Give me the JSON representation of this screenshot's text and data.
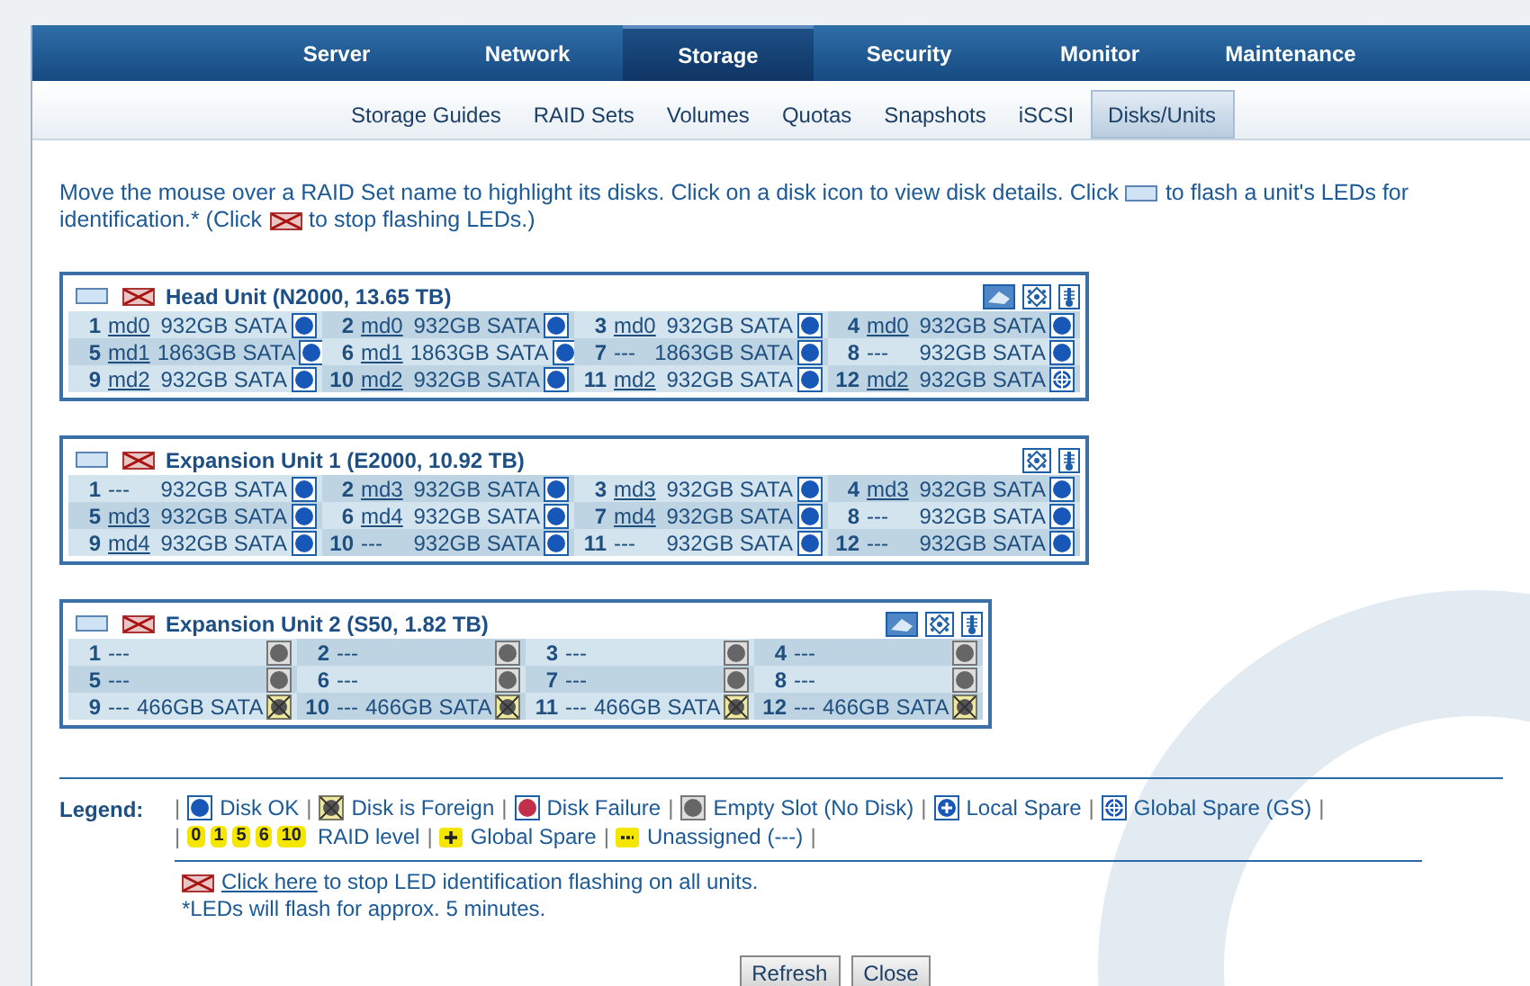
{
  "nav": [
    {
      "label": "Server",
      "selected": false
    },
    {
      "label": "Network",
      "selected": false
    },
    {
      "label": "Storage",
      "selected": true
    },
    {
      "label": "Security",
      "selected": false
    },
    {
      "label": "Monitor",
      "selected": false
    },
    {
      "label": "Maintenance",
      "selected": false
    }
  ],
  "subnav": [
    {
      "label": "Storage Guides",
      "selected": false
    },
    {
      "label": "RAID Sets",
      "selected": false
    },
    {
      "label": "Volumes",
      "selected": false
    },
    {
      "label": "Quotas",
      "selected": false
    },
    {
      "label": "Snapshots",
      "selected": false
    },
    {
      "label": "iSCSI",
      "selected": false
    },
    {
      "label": "Disks/Units",
      "selected": true
    }
  ],
  "intro": {
    "before": "Move the mouse over a RAID Set name to highlight its disks. Click on a disk icon to view disk details. Click",
    "middle": "to flash a unit's LEDs for identification.* (Click",
    "after": "to stop flashing LEDs.)"
  },
  "units": [
    {
      "title": "Head Unit (N2000, 13.65 TB)",
      "icons": [
        {
          "kind": "enclosure"
        },
        {
          "kind": "fan"
        },
        {
          "kind": "temperature"
        }
      ],
      "disks": [
        {
          "number": "1",
          "raid": "md0",
          "linked": true,
          "size": "932GB SATA",
          "kind": "ok"
        },
        {
          "number": "2",
          "raid": "md0",
          "linked": true,
          "size": "932GB SATA",
          "kind": "ok"
        },
        {
          "number": "3",
          "raid": "md0",
          "linked": true,
          "size": "932GB SATA",
          "kind": "ok"
        },
        {
          "number": "4",
          "raid": "md0",
          "linked": true,
          "size": "932GB SATA",
          "kind": "ok"
        },
        {
          "number": "5",
          "raid": "md1",
          "linked": true,
          "size": "1863GB SATA",
          "kind": "ok"
        },
        {
          "number": "6",
          "raid": "md1",
          "linked": true,
          "size": "1863GB SATA",
          "kind": "ok"
        },
        {
          "number": "7",
          "raid": "---",
          "linked": false,
          "size": "1863GB SATA",
          "kind": "ok"
        },
        {
          "number": "8",
          "raid": "---",
          "linked": false,
          "size": "932GB SATA",
          "kind": "ok"
        },
        {
          "number": "9",
          "raid": "md2",
          "linked": true,
          "size": "932GB SATA",
          "kind": "ok"
        },
        {
          "number": "10",
          "raid": "md2",
          "linked": true,
          "size": "932GB SATA",
          "kind": "ok"
        },
        {
          "number": "11",
          "raid": "md2",
          "linked": true,
          "size": "932GB SATA",
          "kind": "ok"
        },
        {
          "number": "12",
          "raid": "md2",
          "linked": true,
          "size": "932GB SATA",
          "kind": "global_spare"
        }
      ]
    },
    {
      "title": "Expansion Unit 1 (E2000, 10.92 TB)",
      "icons": [
        {
          "kind": "fan"
        },
        {
          "kind": "temperature"
        }
      ],
      "disks": [
        {
          "number": "1",
          "raid": "---",
          "linked": false,
          "size": "932GB SATA",
          "kind": "ok"
        },
        {
          "number": "2",
          "raid": "md3",
          "linked": true,
          "size": "932GB SATA",
          "kind": "ok"
        },
        {
          "number": "3",
          "raid": "md3",
          "linked": true,
          "size": "932GB SATA",
          "kind": "ok"
        },
        {
          "number": "4",
          "raid": "md3",
          "linked": true,
          "size": "932GB SATA",
          "kind": "ok"
        },
        {
          "number": "5",
          "raid": "md3",
          "linked": true,
          "size": "932GB SATA",
          "kind": "ok"
        },
        {
          "number": "6",
          "raid": "md4",
          "linked": true,
          "size": "932GB SATA",
          "kind": "ok"
        },
        {
          "number": "7",
          "raid": "md4",
          "linked": true,
          "size": "932GB SATA",
          "kind": "ok"
        },
        {
          "number": "8",
          "raid": "---",
          "linked": false,
          "size": "932GB SATA",
          "kind": "ok"
        },
        {
          "number": "9",
          "raid": "md4",
          "linked": true,
          "size": "932GB SATA",
          "kind": "ok"
        },
        {
          "number": "10",
          "raid": "---",
          "linked": false,
          "size": "932GB SATA",
          "kind": "ok"
        },
        {
          "number": "11",
          "raid": "---",
          "linked": false,
          "size": "932GB SATA",
          "kind": "ok"
        },
        {
          "number": "12",
          "raid": "---",
          "linked": false,
          "size": "932GB SATA",
          "kind": "ok"
        }
      ]
    },
    {
      "title": "Expansion Unit 2 (S50, 1.82 TB)",
      "icons": [
        {
          "kind": "enclosure"
        },
        {
          "kind": "fan"
        },
        {
          "kind": "temperature"
        }
      ],
      "disks": [
        {
          "number": "1",
          "raid": "---",
          "linked": false,
          "kind": "empty"
        },
        {
          "number": "2",
          "raid": "---",
          "linked": false,
          "kind": "empty"
        },
        {
          "number": "3",
          "raid": "---",
          "linked": false,
          "kind": "empty"
        },
        {
          "number": "4",
          "raid": "---",
          "linked": false,
          "kind": "empty"
        },
        {
          "number": "5",
          "raid": "---",
          "linked": false,
          "kind": "empty"
        },
        {
          "number": "6",
          "raid": "---",
          "linked": false,
          "kind": "empty"
        },
        {
          "number": "7",
          "raid": "---",
          "linked": false,
          "kind": "empty"
        },
        {
          "number": "8",
          "raid": "---",
          "linked": false,
          "kind": "empty"
        },
        {
          "number": "9",
          "raid": "---",
          "linked": false,
          "size": "466GB SATA",
          "kind": "foreign"
        },
        {
          "number": "10",
          "raid": "---",
          "linked": false,
          "size": "466GB SATA",
          "kind": "foreign"
        },
        {
          "number": "11",
          "raid": "---",
          "linked": false,
          "size": "466GB SATA",
          "kind": "foreign"
        },
        {
          "number": "12",
          "raid": "---",
          "linked": false,
          "size": "466GB SATA",
          "kind": "foreign"
        }
      ]
    }
  ],
  "legend": {
    "title": "Legend:",
    "separator": "|",
    "statuses": [
      {
        "kind": "ok",
        "label": "Disk OK"
      },
      {
        "kind": "foreign",
        "label": "Disk is Foreign"
      },
      {
        "kind": "failure",
        "label": "Disk Failure"
      },
      {
        "kind": "empty",
        "label": "Empty Slot (No Disk)"
      },
      {
        "kind": "local_spare",
        "label": "Local Spare"
      },
      {
        "kind": "global_spare",
        "label": "Global Spare (GS)"
      }
    ],
    "raid_levels": [
      "0",
      "1",
      "5",
      "6",
      "10"
    ],
    "raid_label": "RAID level",
    "badges": [
      {
        "kind": "gs_badge",
        "label": "Global Spare"
      },
      {
        "kind": "unassigned_badge",
        "label": "Unassigned (---)"
      }
    ]
  },
  "stop_note": {
    "link": "Click here",
    "text": "to stop LED identification flashing on all units."
  },
  "footnote": "*LEDs will flash for approx. 5 minutes.",
  "buttons": [
    "Refresh",
    "Close"
  ]
}
